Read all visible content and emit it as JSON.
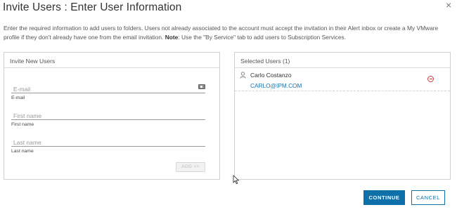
{
  "dialog": {
    "title": "Invite Users : Enter User Information",
    "close_glyph": "×",
    "intro_text": "Enter the required information to add users to folders. Users not already associated to the account must accept the invitation in their Alert inbox or create a My VMware profile if they don't already have one from the email invitation.",
    "note_label": "Note",
    "note_text": ": Use the \"By Service\" tab to add users to Subscription Services."
  },
  "invite_panel": {
    "title": "Invite New Users",
    "email": {
      "placeholder": "E-mail",
      "value": "",
      "label": "E-mail",
      "icon": "contact-card-icon"
    },
    "first_name": {
      "placeholder": "First name",
      "value": "",
      "label": "First name"
    },
    "last_name": {
      "placeholder": "Last name",
      "value": "",
      "label": "Last name"
    },
    "add_button": "ADD >>"
  },
  "selected_panel": {
    "title": "Selected Users (1)",
    "users": [
      {
        "name": "Carlo Costanzo",
        "email": "CARLO@IPM.COM",
        "icon": "user-icon",
        "remove_icon": "remove-circle-icon"
      }
    ]
  },
  "footer": {
    "continue_label": "CONTINUE",
    "cancel_label": "CANCEL"
  },
  "colors": {
    "primary": "#0f6fa8",
    "link": "#0f74b4",
    "danger": "#d13c3c"
  }
}
